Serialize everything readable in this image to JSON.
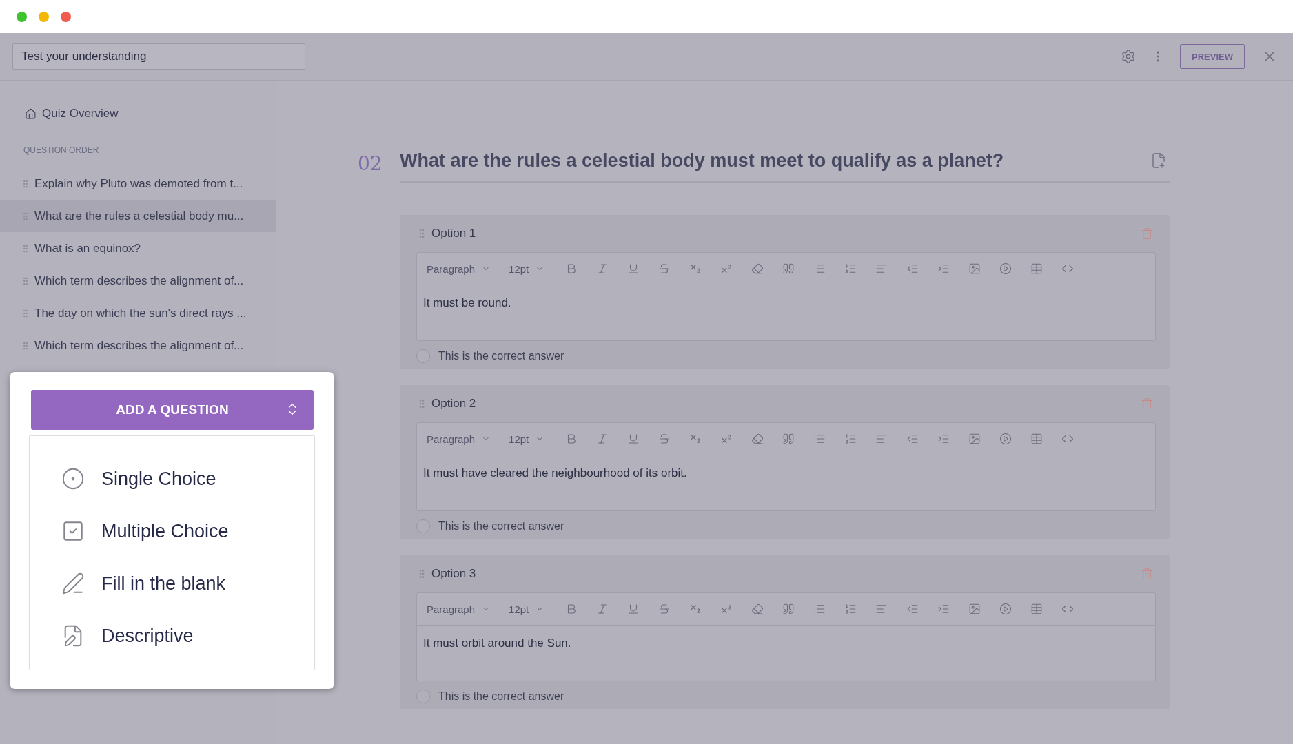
{
  "header": {
    "title_field": "Test your understanding",
    "preview_button": "PREVIEW"
  },
  "sidebar": {
    "overview": "Quiz Overview",
    "section_label": "QUESTION ORDER",
    "items": [
      {
        "label": "Explain why Pluto was demoted from t...",
        "selected": false
      },
      {
        "label": "What are the rules a celestial body mu...",
        "selected": true
      },
      {
        "label": "What is an equinox?",
        "selected": false
      },
      {
        "label": "Which term describes the alignment of...",
        "selected": false
      },
      {
        "label": "The day on which the sun's direct rays ...",
        "selected": false
      },
      {
        "label": "Which term describes the alignment of...",
        "selected": false
      }
    ]
  },
  "question": {
    "number": "02",
    "title": "What are the rules a celestial body must meet to qualify as a planet?"
  },
  "options": [
    {
      "label": "Option 1",
      "block_style": "Paragraph",
      "font_size": "12pt",
      "text": "It must be round.",
      "correct_label": "This is the correct answer",
      "correct": false
    },
    {
      "label": "Option 2",
      "block_style": "Paragraph",
      "font_size": "12pt",
      "text": "It must have cleared the neighbourhood of its orbit.",
      "correct_label": "This is the correct answer",
      "correct": false
    },
    {
      "label": "Option 3",
      "block_style": "Paragraph",
      "font_size": "12pt",
      "text": "It must orbit around the Sun.",
      "correct_label": "This is the correct answer",
      "correct": false
    }
  ],
  "add_question": {
    "button": "ADD A QUESTION",
    "types": [
      {
        "kind": "single",
        "label": "Single Choice"
      },
      {
        "kind": "multiple",
        "label": "Multiple Choice"
      },
      {
        "kind": "fill",
        "label": "Fill in the blank"
      },
      {
        "kind": "descriptive",
        "label": "Descriptive"
      }
    ]
  }
}
